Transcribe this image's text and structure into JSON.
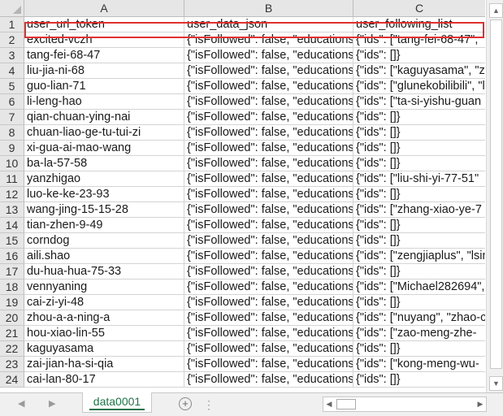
{
  "columns": [
    "A",
    "B",
    "C"
  ],
  "rows": [
    {
      "num": "1",
      "a": "user_url_token",
      "b": "user_data_json",
      "c": "user_following_list"
    },
    {
      "num": "2",
      "a": "excited-vczh",
      "b": "{\"isFollowed\": false, \"educations\"",
      "c": "{\"ids\": [\"tang-fei-68-47\","
    },
    {
      "num": "3",
      "a": "tang-fei-68-47",
      "b": "{\"isFollowed\": false, \"educations\"",
      "c": "{\"ids\": []}"
    },
    {
      "num": "4",
      "a": "liu-jia-ni-68",
      "b": "{\"isFollowed\": false, \"educations\"",
      "c": "{\"ids\": [\"kaguyasama\", \"za"
    },
    {
      "num": "5",
      "a": "guo-lian-71",
      "b": "{\"isFollowed\": false, \"educations\"",
      "c": "{\"ids\": [\"glunekobilibili\", \"lu"
    },
    {
      "num": "6",
      "a": "li-leng-hao",
      "b": "{\"isFollowed\": false, \"educations\"",
      "c": "{\"ids\": [\"ta-si-yishu-guan"
    },
    {
      "num": "7",
      "a": "qian-chuan-ying-nai",
      "b": "{\"isFollowed\": false, \"educations\"",
      "c": "{\"ids\": []}"
    },
    {
      "num": "8",
      "a": "chuan-liao-ge-tu-tui-zi",
      "b": "{\"isFollowed\": false, \"educations\"",
      "c": "{\"ids\": []}"
    },
    {
      "num": "9",
      "a": "xi-gua-ai-mao-wang",
      "b": "{\"isFollowed\": false, \"educations\"",
      "c": "{\"ids\": []}"
    },
    {
      "num": "10",
      "a": "ba-la-57-58",
      "b": "{\"isFollowed\": false, \"educations\"",
      "c": "{\"ids\": []}"
    },
    {
      "num": "11",
      "a": "yanzhigao",
      "b": "{\"isFollowed\": false, \"educations\"",
      "c": "{\"ids\": [\"liu-shi-yi-77-51\""
    },
    {
      "num": "12",
      "a": "luo-ke-ke-23-93",
      "b": "{\"isFollowed\": false, \"educations\"",
      "c": "{\"ids\": []}"
    },
    {
      "num": "13",
      "a": "wang-jing-15-15-28",
      "b": "{\"isFollowed\": false, \"educations\"",
      "c": "{\"ids\": [\"zhang-xiao-ye-7"
    },
    {
      "num": "14",
      "a": "tian-zhen-9-49",
      "b": "{\"isFollowed\": false, \"educations\"",
      "c": "{\"ids\": []}"
    },
    {
      "num": "15",
      "a": "corndog",
      "b": "{\"isFollowed\": false, \"educations\"",
      "c": "{\"ids\": []}"
    },
    {
      "num": "16",
      "a": "aili.shao",
      "b": "{\"isFollowed\": false, \"educations\"",
      "c": "{\"ids\": [\"zengjiaplus\", \"lsin"
    },
    {
      "num": "17",
      "a": "du-hua-hua-75-33",
      "b": "{\"isFollowed\": false, \"educations\"",
      "c": "{\"ids\": []}"
    },
    {
      "num": "18",
      "a": "vennyaning",
      "b": "{\"isFollowed\": false, \"educations\"",
      "c": "{\"ids\": [\"Michael282694\","
    },
    {
      "num": "19",
      "a": "cai-zi-yi-48",
      "b": "{\"isFollowed\": false, \"educations\"",
      "c": "{\"ids\": []}"
    },
    {
      "num": "20",
      "a": "zhou-a-a-ning-a",
      "b": "{\"isFollowed\": false, \"educations\"",
      "c": "{\"ids\": [\"nuyang\", \"zhao-c"
    },
    {
      "num": "21",
      "a": "hou-xiao-lin-55",
      "b": "{\"isFollowed\": false, \"educations\"",
      "c": "{\"ids\": [\"zao-meng-zhe-"
    },
    {
      "num": "22",
      "a": "kaguyasama",
      "b": "{\"isFollowed\": false, \"educations\"",
      "c": "{\"ids\": []}"
    },
    {
      "num": "23",
      "a": "zai-jian-ha-si-qia",
      "b": "{\"isFollowed\": false, \"educations\"",
      "c": "{\"ids\": [\"kong-meng-wu-"
    },
    {
      "num": "24",
      "a": "cai-lan-80-17",
      "b": "{\"isFollowed\": false, \"educations\"",
      "c": "{\"ids\": []}"
    }
  ],
  "sheet_tab": "data0001",
  "add_sheet_glyph": "+",
  "nav": {
    "prev": "◀",
    "next": "▶",
    "split": "⋮"
  },
  "colors": {
    "highlight": "#e03131",
    "sheet_tab_text": "#217346"
  }
}
